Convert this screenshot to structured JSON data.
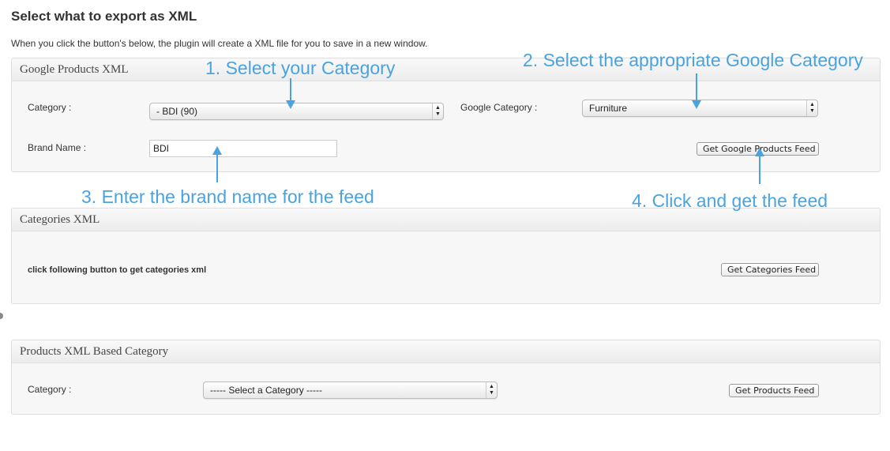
{
  "page": {
    "title": "Select what to export as XML",
    "intro": "When you click the button's below, the plugin will create a XML file for you to save in a new window."
  },
  "google_section": {
    "header": "Google Products XML",
    "category_label": "Category :",
    "category_value": "- BDI (90)",
    "google_category_label": "Google Category :",
    "google_category_value": "Furniture",
    "brand_label": "Brand Name :",
    "brand_value": "BDI",
    "button": "Get Google Products Feed"
  },
  "categories_section": {
    "header": "Categories XML",
    "note": "click following button to get categories xml",
    "button": "Get Categories Feed"
  },
  "products_section": {
    "header": "Products XML Based Category",
    "category_label": "Category :",
    "category_value": "----- Select a Category -----",
    "button": "Get Products Feed"
  },
  "annotations": {
    "step1": "1. Select your Category",
    "step2": "2. Select the appropriate Google Category",
    "step3": "3. Enter the brand name for the feed",
    "step4": "4. Click and get the feed",
    "color": "#4aa3df"
  },
  "icons": {
    "select_arrows": "up-down-arrows-icon",
    "annotation_arrow": "arrow-icon"
  }
}
